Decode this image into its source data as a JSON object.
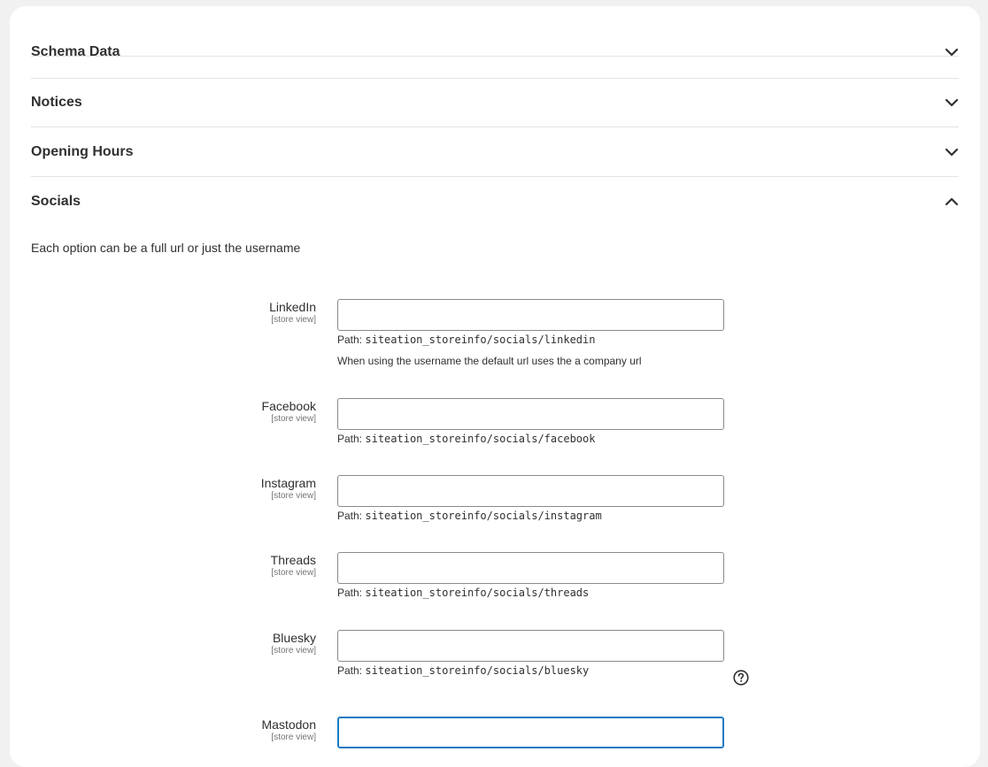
{
  "sections": {
    "schema": {
      "title": "Schema Data",
      "expanded": false
    },
    "notices": {
      "title": "Notices",
      "expanded": false
    },
    "opening_hours": {
      "title": "Opening Hours",
      "expanded": false
    },
    "socials": {
      "title": "Socials",
      "expanded": true
    }
  },
  "socials": {
    "intro": "Each option can be a full url or just the username",
    "path_prefix": "Path:",
    "fields": [
      {
        "label": "LinkedIn",
        "scope": "[store view]",
        "value": "",
        "path": "siteation_storeinfo/socials/linkedin",
        "comment": "When using the username the default url uses the a company url"
      },
      {
        "label": "Facebook",
        "scope": "[store view]",
        "value": "",
        "path": "siteation_storeinfo/socials/facebook"
      },
      {
        "label": "Instagram",
        "scope": "[store view]",
        "value": "",
        "path": "siteation_storeinfo/socials/instagram"
      },
      {
        "label": "Threads",
        "scope": "[store view]",
        "value": "",
        "path": "siteation_storeinfo/socials/threads"
      },
      {
        "label": "Bluesky",
        "scope": "[store view]",
        "value": "",
        "path": "siteation_storeinfo/socials/bluesky"
      },
      {
        "label": "Mastodon",
        "scope": "[store view]",
        "value": ""
      }
    ]
  },
  "icons": {
    "collapse": "chevron-down-icon",
    "expand": "chevron-up-icon",
    "help": "help-circle-icon"
  },
  "colors": {
    "focus": "#1979c3",
    "border": "#8a8a8a",
    "text": "#303030"
  }
}
